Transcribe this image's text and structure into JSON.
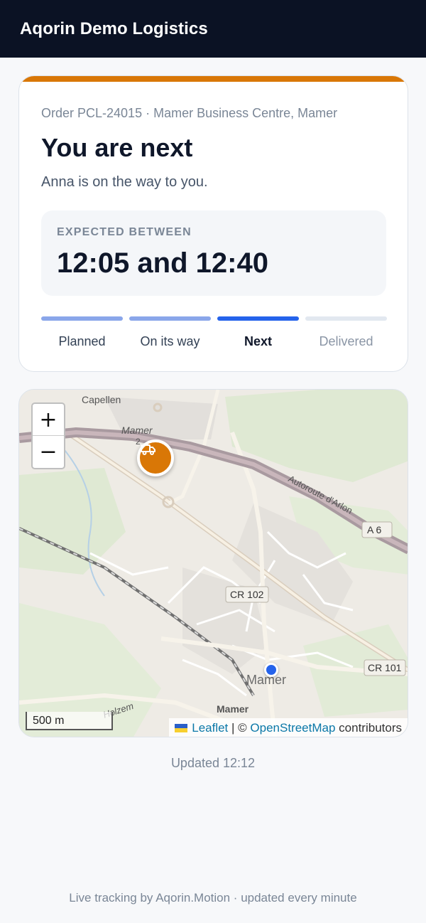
{
  "header": {
    "title": "Aqorin Demo Logistics"
  },
  "status_card": {
    "order_line": "Order PCL-24015 · Mamer Business Centre, Mamer",
    "headline": "You are next",
    "subline": "Anna is on the way to you.",
    "window_label": "EXPECTED BETWEEN",
    "window_value": "12:05 and 12:40",
    "accent_color": "#d97706",
    "steps": [
      {
        "label": "Planned",
        "state": "done"
      },
      {
        "label": "On its way",
        "state": "done"
      },
      {
        "label": "Next",
        "state": "current"
      },
      {
        "label": "Delivered",
        "state": "todo"
      }
    ]
  },
  "map": {
    "zoom_in": "+",
    "zoom_out": "−",
    "scale_label": "500 m",
    "labels": {
      "capellen": "Capellen",
      "mamer_exit": "Mamer",
      "mamer_exit_num": "2",
      "autoroute": "Autoroute d'Arlon",
      "a6": "A 6",
      "cr102": "CR 102",
      "cr101": "CR 101",
      "mamer_town": "Mamer",
      "mamer_small": "Mamer",
      "holzem": "Holzem"
    },
    "truck_marker_icon": "truck-icon",
    "destination_marker_color": "#2563eb",
    "attribution": {
      "leaflet": "Leaflet",
      "separator": "| ©",
      "osm": "OpenStreetMap",
      "suffix": "contributors"
    }
  },
  "updated": "Updated 12:12",
  "footer": "Live tracking by Aqorin.Motion · updated every minute"
}
